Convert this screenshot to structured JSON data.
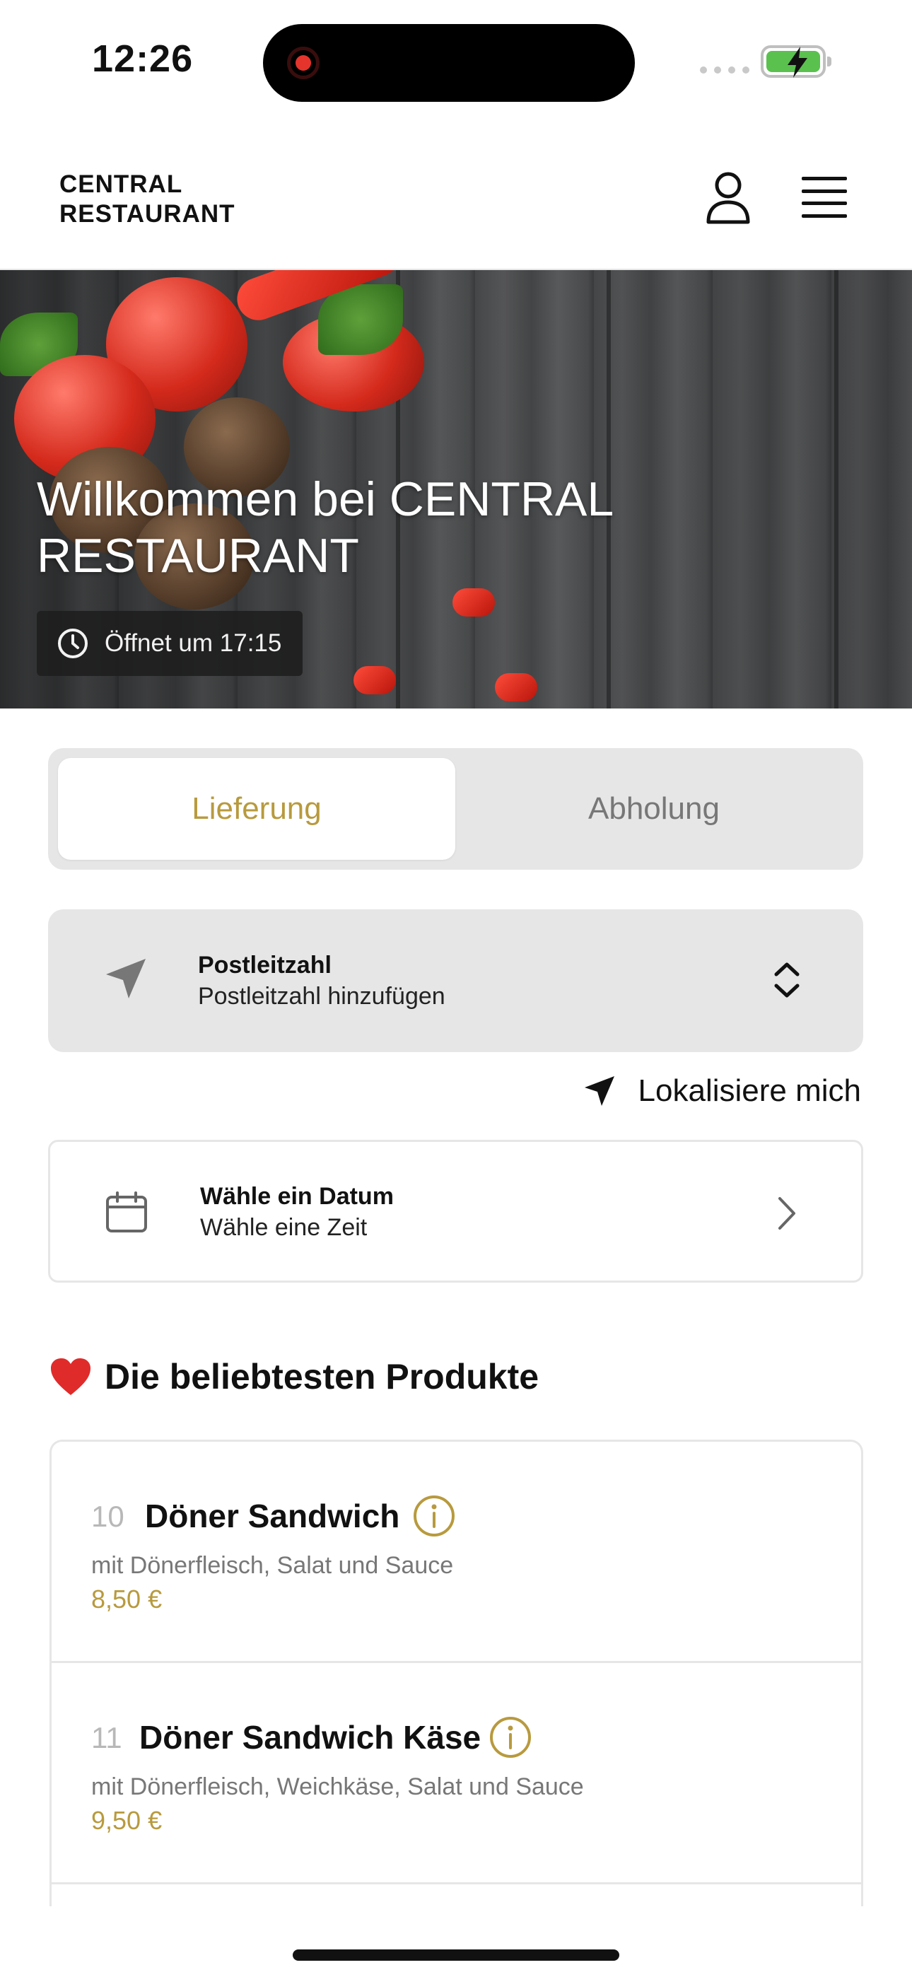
{
  "status_bar": {
    "time": "12:26"
  },
  "header": {
    "brand": "CENTRAL\nRESTAURANT"
  },
  "hero": {
    "title": "Willkommen bei CENTRAL RESTAURANT",
    "hours": "Öffnet um 17:15"
  },
  "mode_toggle": {
    "options": [
      {
        "label": "Lieferung",
        "active": true
      },
      {
        "label": "Abholung",
        "active": false
      }
    ]
  },
  "postal": {
    "label": "Postleitzahl",
    "value": "Postleitzahl hinzufügen"
  },
  "locate_label": "Lokalisiere mich",
  "date": {
    "label": "Wähle ein Datum",
    "value": "Wähle eine Zeit"
  },
  "popular": {
    "title": "Die beliebtesten Produkte",
    "products": [
      {
        "number": "10",
        "name": "Döner Sandwich",
        "description": "mit Dönerfleisch, Salat und Sauce",
        "price": "8,50 €"
      },
      {
        "number": "11",
        "name": "Döner Sandwich Käse",
        "description": "mit Dönerfleisch, Weichkäse, Salat und Sauce",
        "price": "9,50 €"
      }
    ]
  },
  "colors": {
    "accent": "#b89a3e",
    "muted_bg": "#e6e6e6"
  }
}
